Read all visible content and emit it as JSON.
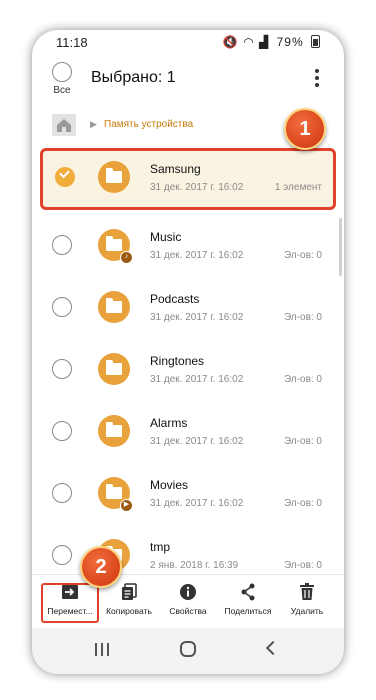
{
  "statusbar": {
    "time": "11:18",
    "battery": "79%"
  },
  "header": {
    "all_label": "Все",
    "title": "Выбрано: 1"
  },
  "path": {
    "location": "Память устройства"
  },
  "badges": {
    "one": "1",
    "two": "2"
  },
  "files": [
    {
      "name": "Samsung",
      "date": "31 дек. 2017 г. 16:02",
      "count": "1 элемент",
      "selected": true
    },
    {
      "name": "Music",
      "date": "31 дек. 2017 г. 16:02",
      "count": "Эл-ов: 0",
      "overlay": "music"
    },
    {
      "name": "Podcasts",
      "date": "31 дек. 2017 г. 16:02",
      "count": "Эл-ов: 0"
    },
    {
      "name": "Ringtones",
      "date": "31 дек. 2017 г. 16:02",
      "count": "Эл-ов: 0"
    },
    {
      "name": "Alarms",
      "date": "31 дек. 2017 г. 16:02",
      "count": "Эл-ов: 0"
    },
    {
      "name": "Movies",
      "date": "31 дек. 2017 г. 16:02",
      "count": "Эл-ов: 0",
      "overlay": "play"
    },
    {
      "name": "tmp",
      "date": "2 янв. 2018 г. 16:39",
      "count": "Эл-ов: 0"
    }
  ],
  "actions": [
    {
      "label": "Перемест...",
      "icon": "move-icon"
    },
    {
      "label": "Копировать",
      "icon": "copy-icon"
    },
    {
      "label": "Свойства",
      "icon": "info-icon"
    },
    {
      "label": "Поделиться",
      "icon": "share-icon"
    },
    {
      "label": "Удалить",
      "icon": "trash-icon"
    }
  ],
  "colors": {
    "accent": "#e9a23b",
    "highlight": "#e0412a",
    "path": "#c8790b"
  }
}
